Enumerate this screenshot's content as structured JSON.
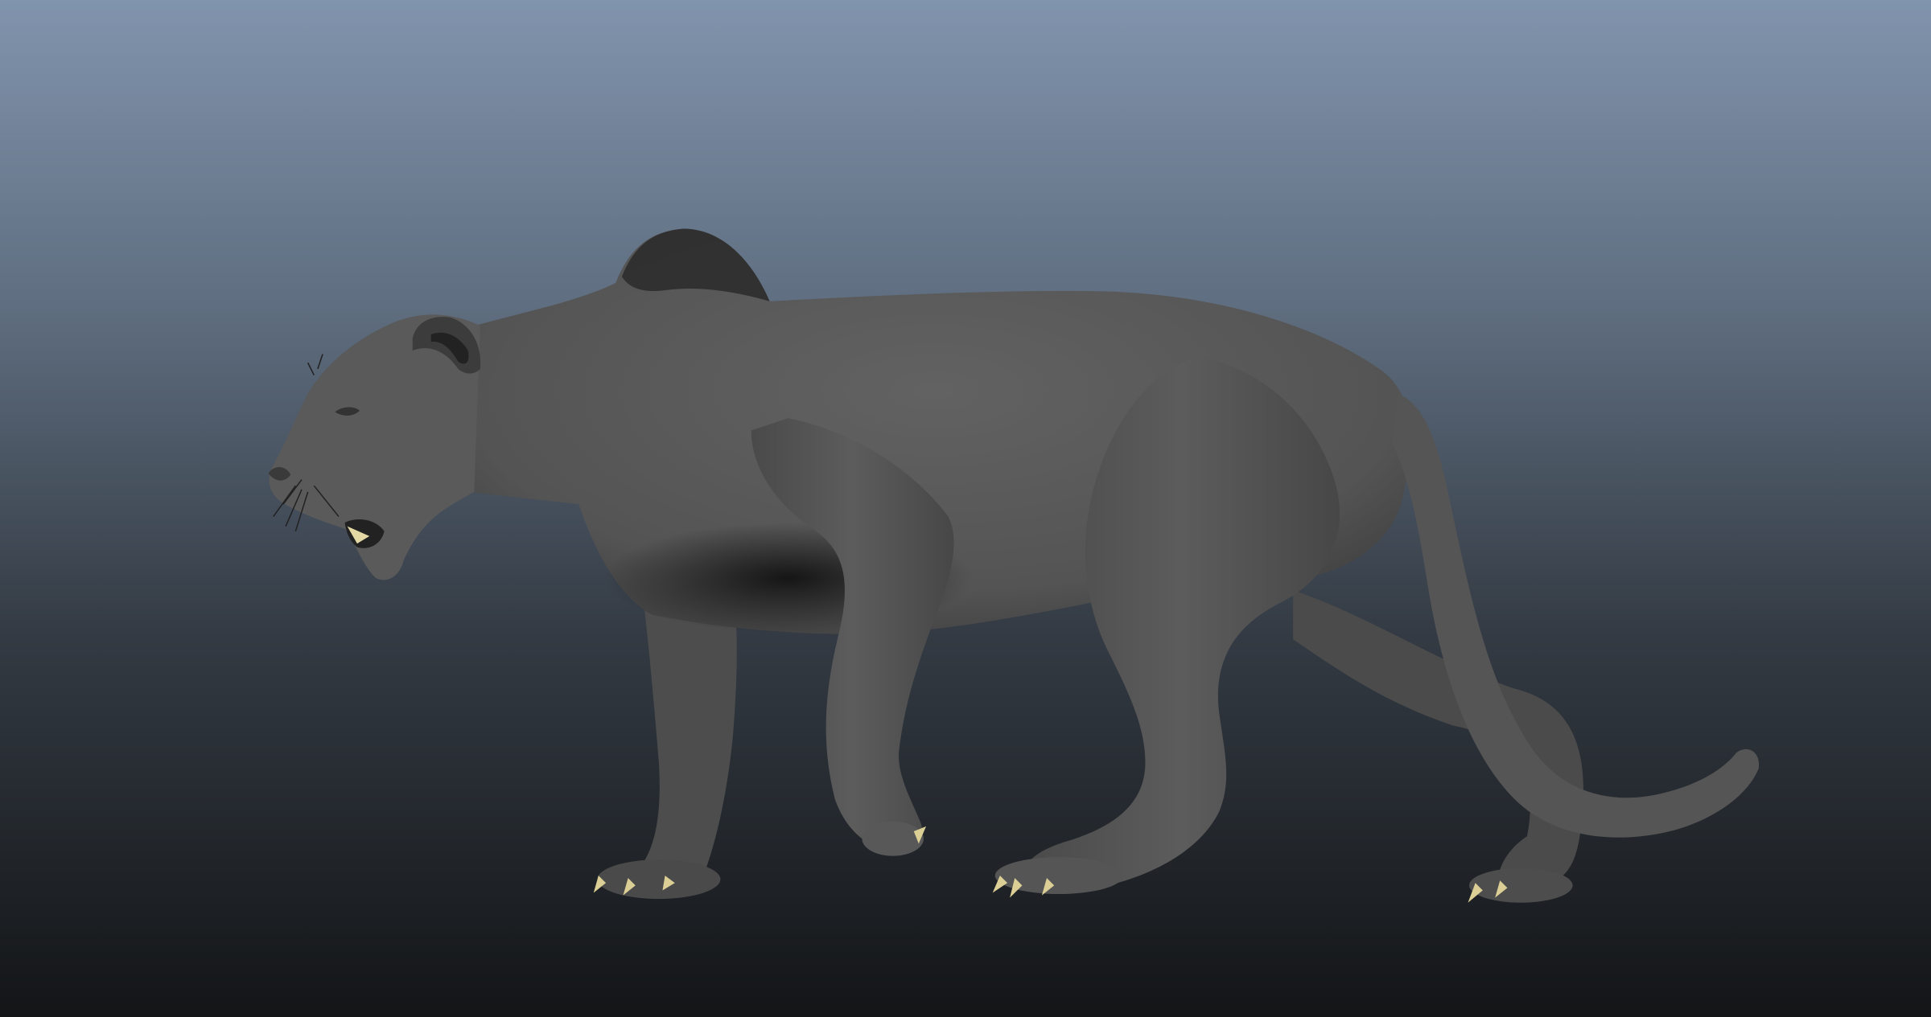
{
  "viewport": {
    "name": "3d-viewport",
    "background_top_color": "#8194ad",
    "background_bottom_color": "#131517"
  },
  "model": {
    "subject": "lioness-sculpt",
    "body_color": "#575757",
    "shadow_color": "#0b0b0b",
    "claw_color": "#dccf95"
  }
}
